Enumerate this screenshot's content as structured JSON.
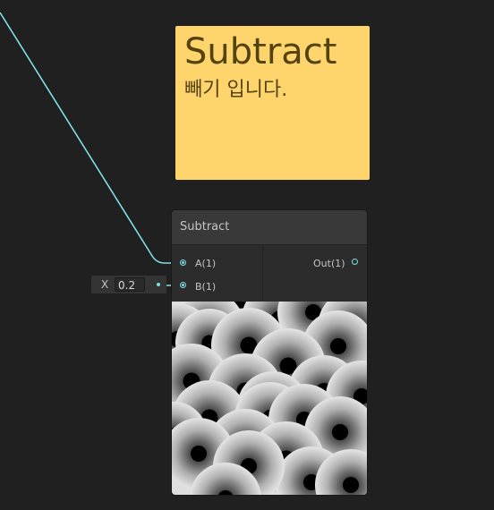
{
  "sticky_note": {
    "title": "Subtract",
    "body": "빼기 입니다."
  },
  "node": {
    "title": "Subtract",
    "inputs": [
      {
        "label": "A(1)",
        "connected": true
      },
      {
        "label": "B(1)",
        "connected": true
      }
    ],
    "outputs": [
      {
        "label": "Out(1)",
        "connected": false
      }
    ]
  },
  "inline_value": {
    "axis": "X",
    "value": "0.2"
  },
  "colors": {
    "canvas_background": "#202020",
    "sticky_note": "#fed56d",
    "sticky_text": "#54420f",
    "edge_float": "#7ee0e5",
    "node_header": "#393939",
    "node_body": "#2c2c2c"
  }
}
